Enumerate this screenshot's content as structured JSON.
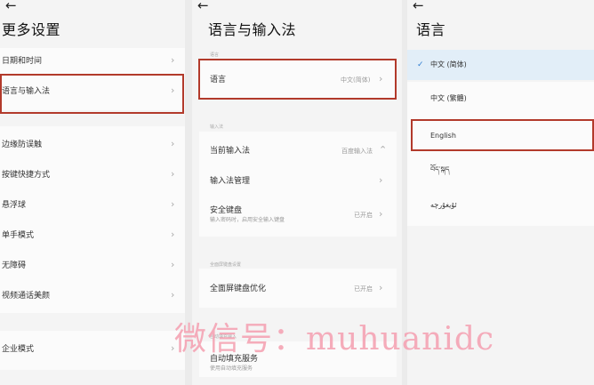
{
  "panel1": {
    "back_glyph": "←",
    "title": "更多设置",
    "items": [
      {
        "label": "日期和时间"
      },
      {
        "label": "语言与输入法"
      },
      {
        "label": "边缘防误触"
      },
      {
        "label": "按键快捷方式"
      },
      {
        "label": "悬浮球"
      },
      {
        "label": "单手模式"
      },
      {
        "label": "无障碍"
      },
      {
        "label": "视频通话美颜"
      },
      {
        "label": "企业模式"
      }
    ],
    "chevron": "›"
  },
  "panel2": {
    "back_glyph": "←",
    "title": "语言与输入法",
    "section_language": "语言",
    "language_label": "语言",
    "language_value": "中文(简体)",
    "section_input": "输入法",
    "current_ime_label": "当前输入法",
    "current_ime_value": "百度输入法",
    "ime_manage_label": "输入法管理",
    "secure_keyboard_label": "安全键盘",
    "secure_keyboard_sub": "输入密码时，启用安全输入键盘",
    "secure_keyboard_value": "已开启",
    "section_fullscreen": "全面屏键盘设置",
    "fullscreen_opt_label": "全面屏键盘优化",
    "fullscreen_opt_value": "已开启",
    "section_autofill": "自动填充输入",
    "autofill_label": "自动填充服务",
    "autofill_sub": "使用自动填充服务",
    "chevron": "›",
    "updown": "⌃"
  },
  "panel3": {
    "back_glyph": "←",
    "title": "语言",
    "check_glyph": "✓",
    "languages": [
      {
        "label": "中文 (简体)",
        "selected": true
      },
      {
        "label": "中文 (繁體)",
        "selected": false
      },
      {
        "label": "English",
        "selected": false
      },
      {
        "label": "བོད་སྐད",
        "selected": false
      },
      {
        "label": "ئۇيغۇرچە",
        "selected": false
      }
    ]
  },
  "watermark": "微信号：muhuanidc",
  "colors": {
    "highlight": "#b23a2b",
    "check": "#2f7dd1",
    "watermark": "#f5a4b4"
  }
}
